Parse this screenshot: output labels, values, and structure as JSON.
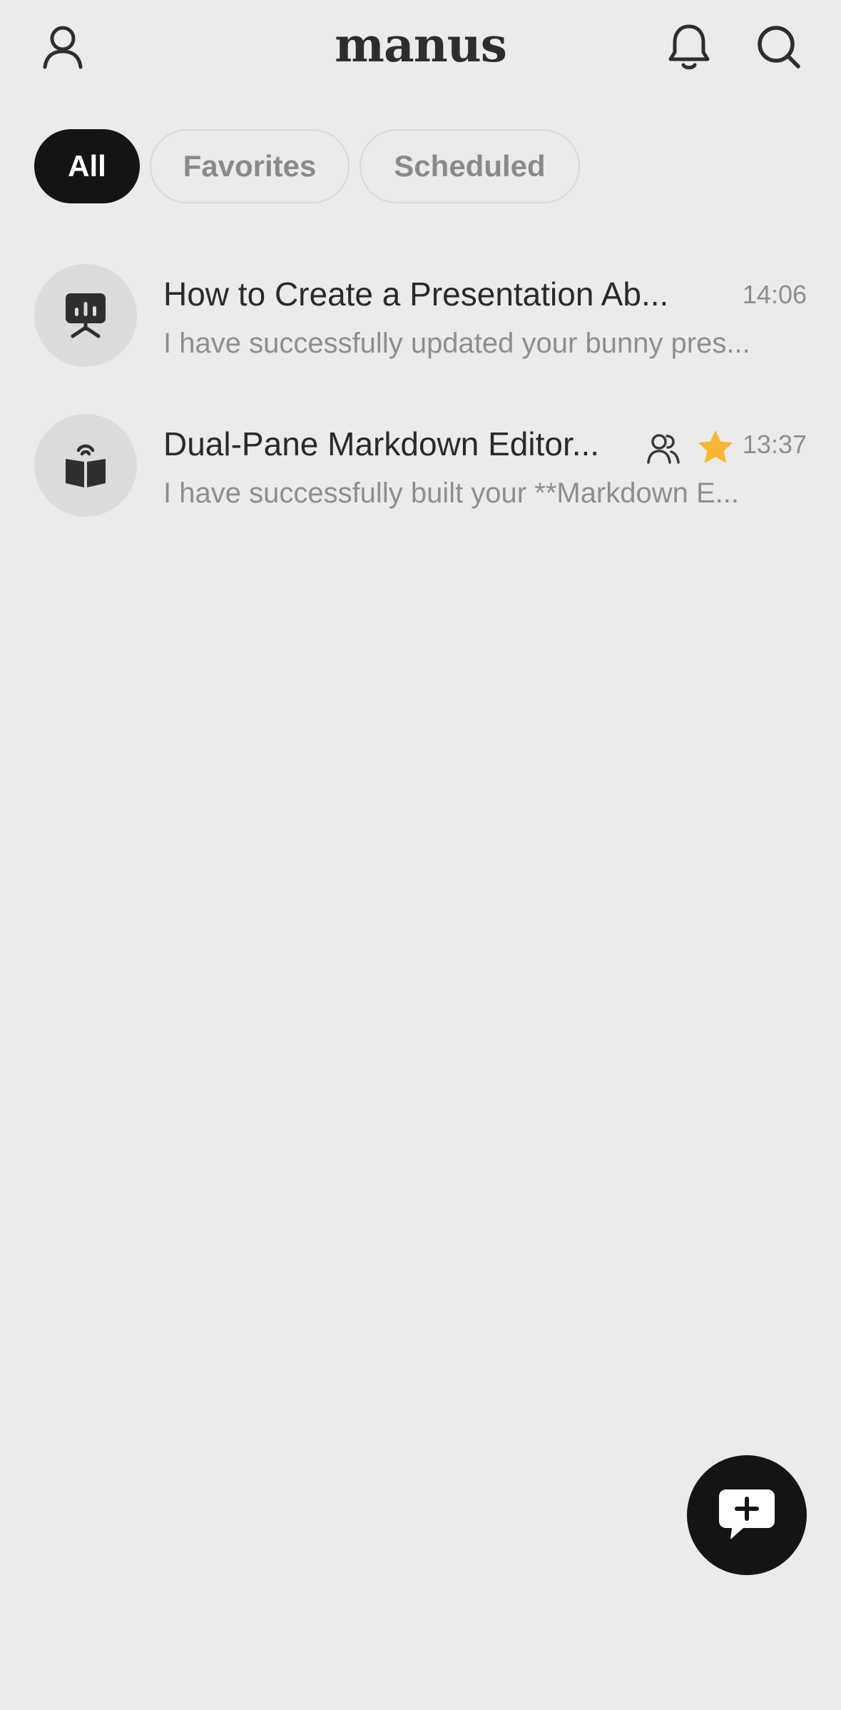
{
  "header": {
    "logo": "manus",
    "profile_icon": "user-icon",
    "notifications_icon": "bell-icon",
    "search_icon": "search-icon"
  },
  "tabs": [
    {
      "label": "All",
      "active": true
    },
    {
      "label": "Favorites",
      "active": false
    },
    {
      "label": "Scheduled",
      "active": false
    }
  ],
  "tasks": [
    {
      "icon": "presentation-icon",
      "title": "How to Create a Presentation Ab...",
      "time": "14:06",
      "preview": "I have successfully updated your bunny pres..."
    },
    {
      "icon": "book-icon",
      "title": "Dual-Pane Markdown Editor...",
      "time": "13:37",
      "preview": "I have successfully built your **Markdown E...",
      "shared": true,
      "favorite": true
    }
  ],
  "fab": {
    "icon": "new-chat-icon"
  },
  "colors": {
    "background": "#ebebeb",
    "active_tab": "#141414",
    "star": "#f7b733"
  }
}
